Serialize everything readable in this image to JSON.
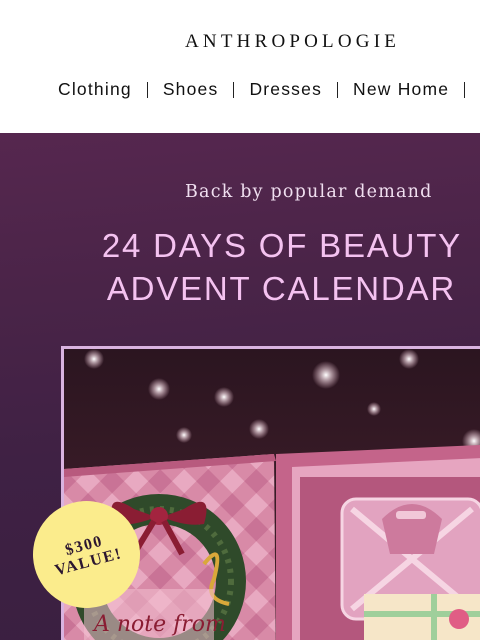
{
  "header": {
    "brand": "ANTHROPOLOGIE",
    "nav": [
      {
        "label": "Clothing"
      },
      {
        "label": "Shoes"
      },
      {
        "label": "Dresses"
      },
      {
        "label": "New Home"
      }
    ]
  },
  "hero": {
    "tagline": "Back by popular demand",
    "title_line1": "24 DAYS OF BEAUTY",
    "title_line2": "ADVENT CALENDAR",
    "badge_line1": "$300",
    "badge_line2": "VALUE!",
    "image_script_text": "A note from",
    "colors": {
      "hero_bg": "#4a2448",
      "title": "#f4c2f0",
      "badge": "#fbec8c",
      "frame": "#d9b3e0"
    }
  }
}
